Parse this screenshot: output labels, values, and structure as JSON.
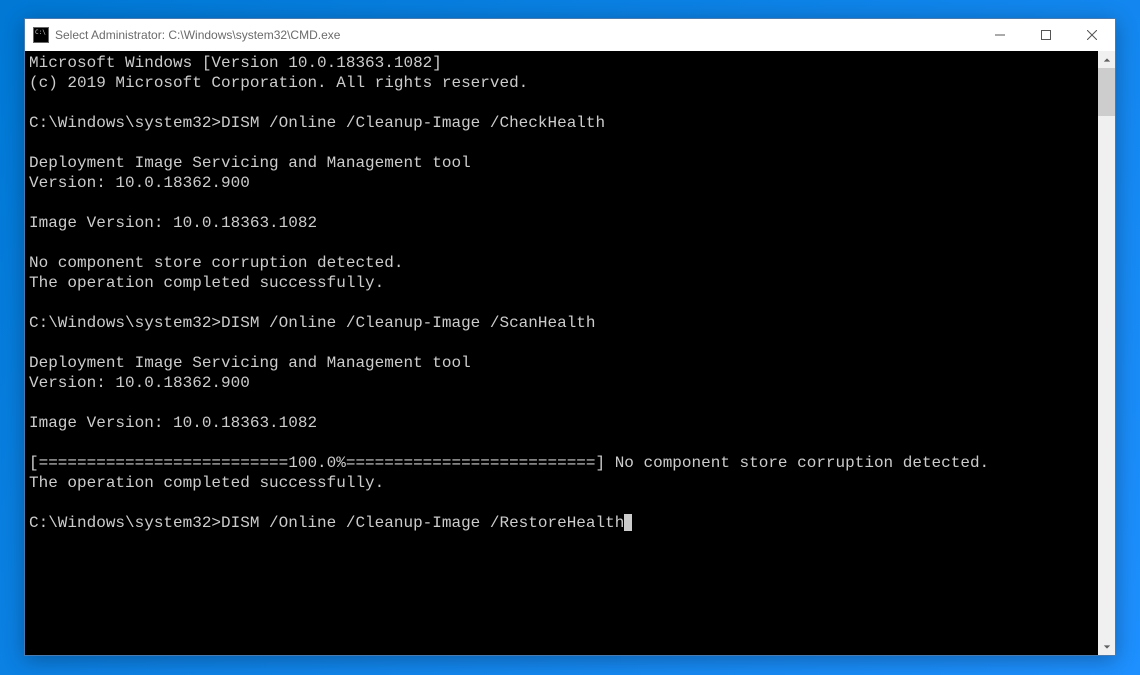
{
  "window": {
    "title": "Select Administrator: C:\\Windows\\system32\\CMD.exe"
  },
  "terminal": {
    "lines": [
      "Microsoft Windows [Version 10.0.18363.1082]",
      "(c) 2019 Microsoft Corporation. All rights reserved.",
      "",
      "C:\\Windows\\system32>DISM /Online /Cleanup-Image /CheckHealth",
      "",
      "Deployment Image Servicing and Management tool",
      "Version: 10.0.18362.900",
      "",
      "Image Version: 10.0.18363.1082",
      "",
      "No component store corruption detected.",
      "The operation completed successfully.",
      "",
      "C:\\Windows\\system32>DISM /Online /Cleanup-Image /ScanHealth",
      "",
      "Deployment Image Servicing and Management tool",
      "Version: 10.0.18362.900",
      "",
      "Image Version: 10.0.18363.1082",
      "",
      "[==========================100.0%==========================] No component store corruption detected.",
      "The operation completed successfully.",
      "",
      "C:\\Windows\\system32>DISM /Online /Cleanup-Image /RestoreHealth"
    ]
  }
}
